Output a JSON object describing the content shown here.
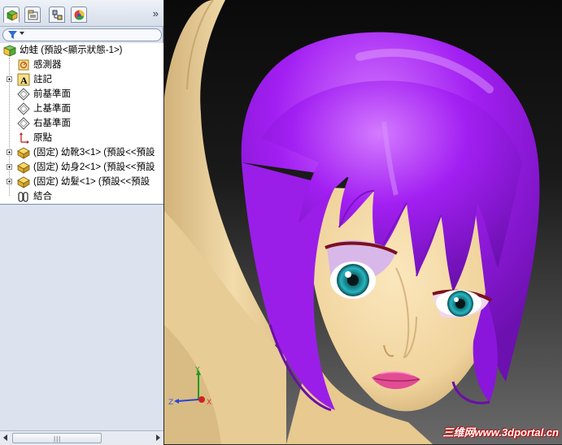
{
  "panel": {
    "tabs": [
      {
        "name": "feature-manager-tab",
        "active": true
      },
      {
        "name": "property-manager-tab",
        "active": false
      },
      {
        "name": "configuration-manager-tab",
        "active": false
      },
      {
        "name": "display-manager-tab",
        "active": false
      }
    ],
    "expand_label": "»",
    "filter_icon": "filter-icon"
  },
  "tree": {
    "root": "幼蛙  (預設<顯示狀態-1>)",
    "items": [
      {
        "label": "感測器",
        "icon": "sensor-icon",
        "expandable": false
      },
      {
        "label": "註記",
        "icon": "annotation-icon",
        "expandable": true
      },
      {
        "label": "前基準面",
        "icon": "plane-icon",
        "expandable": false
      },
      {
        "label": "上基準面",
        "icon": "plane-icon",
        "expandable": false
      },
      {
        "label": "右基準面",
        "icon": "plane-icon",
        "expandable": false
      },
      {
        "label": "原點",
        "icon": "origin-icon",
        "expandable": false
      },
      {
        "label": "(固定) 幼靴3<1> (預設<<預設",
        "icon": "part-icon",
        "expandable": true
      },
      {
        "label": "(固定) 幼身2<1> (預設<<預設",
        "icon": "part-icon",
        "expandable": true
      },
      {
        "label": "(固定) 幼髮<1> (預設<<預設",
        "icon": "part-icon",
        "expandable": true
      },
      {
        "label": "結合",
        "icon": "mates-icon",
        "expandable": false
      }
    ]
  },
  "viewport": {
    "watermark": "三维网www.3dportal.cn",
    "triad": {
      "x": "X",
      "y": "Y",
      "z": "Z"
    },
    "colors": {
      "hair": "#a020f0",
      "skin": "#f2d7a4",
      "eye": "#1aa0a8",
      "lips": "#e0508a"
    }
  }
}
